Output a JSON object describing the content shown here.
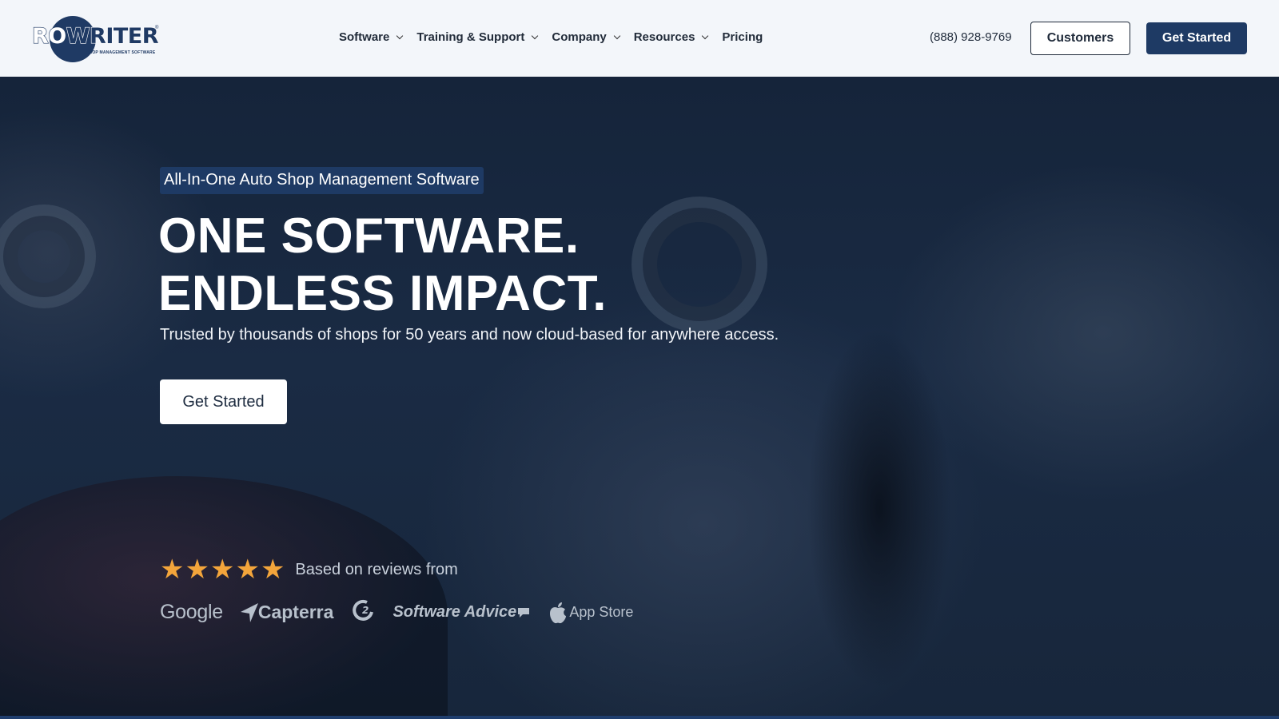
{
  "header": {
    "logo_text_light": "RO",
    "logo_text_dark": "WRITER",
    "logo_registered": "®",
    "logo_tagline": "SHOP MANAGEMENT SOFTWARE",
    "nav": [
      {
        "label": "Software",
        "has_dropdown": true
      },
      {
        "label": "Training & Support",
        "has_dropdown": true
      },
      {
        "label": "Company",
        "has_dropdown": true
      },
      {
        "label": "Resources",
        "has_dropdown": true
      },
      {
        "label": "Pricing",
        "has_dropdown": false
      }
    ],
    "phone": "(888) 928-9769",
    "customers_label": "Customers",
    "get_started_label": "Get Started"
  },
  "hero": {
    "eyebrow": "All-In-One Auto Shop Management Software",
    "headline_line1": "ONE SOFTWARE.",
    "headline_line2": "ENDLESS IMPACT.",
    "subhead": "Trusted by thousands of shops for 50 years and now cloud-based for anywhere access.",
    "cta_label": "Get Started",
    "rating_stars": 5,
    "reviews_text": "Based on reviews from",
    "review_sources": {
      "google": "Google",
      "capterra": "Capterra",
      "g2": "G2",
      "software_advice": "Software Advice",
      "app_store": "App Store"
    }
  },
  "colors": {
    "brand_navy": "#1e3a64",
    "star": "#f3a53b",
    "header_bg": "#f3f6fa"
  },
  "icons": [
    "chevron-down-icon",
    "star-icon",
    "capterra-icon",
    "apple-icon"
  ]
}
